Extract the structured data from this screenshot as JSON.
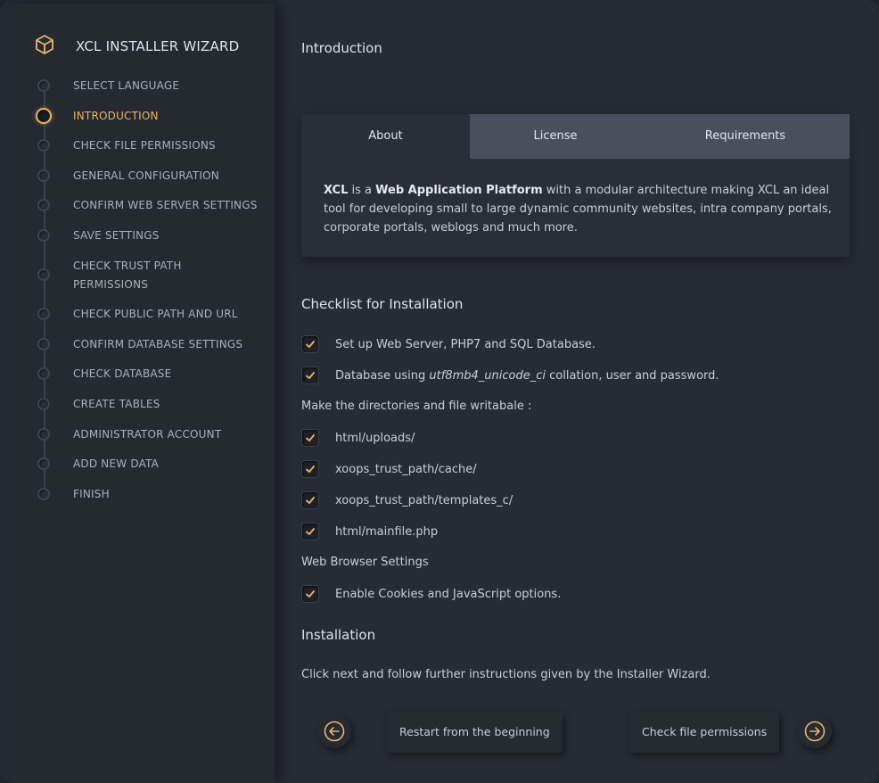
{
  "sidebar": {
    "title": "XCL INSTALLER WIZARD",
    "brand_icon": "cube-icon",
    "steps": [
      {
        "label": "SELECT LANGUAGE",
        "active": false
      },
      {
        "label": "INTRODUCTION",
        "active": true
      },
      {
        "label": "CHECK FILE PERMISSIONS",
        "active": false
      },
      {
        "label": "GENERAL CONFIGURATION",
        "active": false
      },
      {
        "label": "CONFIRM WEB SERVER SETTINGS",
        "active": false
      },
      {
        "label": "SAVE SETTINGS",
        "active": false
      },
      {
        "label": "CHECK TRUST PATH PERMISSIONS",
        "active": false
      },
      {
        "label": "CHECK PUBLIC PATH AND URL",
        "active": false
      },
      {
        "label": "CONFIRM DATABASE SETTINGS",
        "active": false
      },
      {
        "label": "CHECK DATABASE",
        "active": false
      },
      {
        "label": "CREATE TABLES",
        "active": false
      },
      {
        "label": "ADMINISTRATOR ACCOUNT",
        "active": false
      },
      {
        "label": "ADD NEW DATA",
        "active": false
      },
      {
        "label": "FINISH",
        "active": false
      }
    ]
  },
  "main": {
    "heading": "Introduction",
    "tabs": [
      {
        "label": "About",
        "active": true
      },
      {
        "label": "License",
        "active": false
      },
      {
        "label": "Requirements",
        "active": false
      }
    ],
    "about": {
      "p1": "XCL",
      "p2": " is a ",
      "p3": "Web Application Platform",
      "p4": " with a modular architecture making XCL an ideal tool for developing small to large dynamic community websites, intra company portals, corporate portals, weblogs and much more."
    },
    "checklist_heading": "Checklist for Installation",
    "checklist": {
      "item1": "Set up Web Server, PHP7 and SQL Database.",
      "item2_pre": "Database using ",
      "item2_em": "utf8mb4_unicode_ci",
      "item2_post": " collation, user and password.",
      "dirs_label": "Make the directories and file writabale :",
      "dir1": "html/uploads/",
      "dir2": "xoops_trust_path/cache/",
      "dir3": "xoops_trust_path/templates_c/",
      "dir4": "html/mainfile.php",
      "browser_label": "Web Browser Settings",
      "browser1": "Enable Cookies and JavaScript options."
    },
    "installation_heading": "Installation",
    "installation_text": "Click next and follow further instructions given by the Installer Wizard.",
    "nav": {
      "prev_icon": "arrow-left-circle-icon",
      "prev_label": "Restart from the beginning",
      "next_label": "Check file permissions",
      "next_icon": "arrow-right-circle-icon"
    }
  },
  "colors": {
    "accent": "#e8b56b",
    "background": "#272b33",
    "sidebar": "#252930",
    "tabbar": "#49505c"
  }
}
